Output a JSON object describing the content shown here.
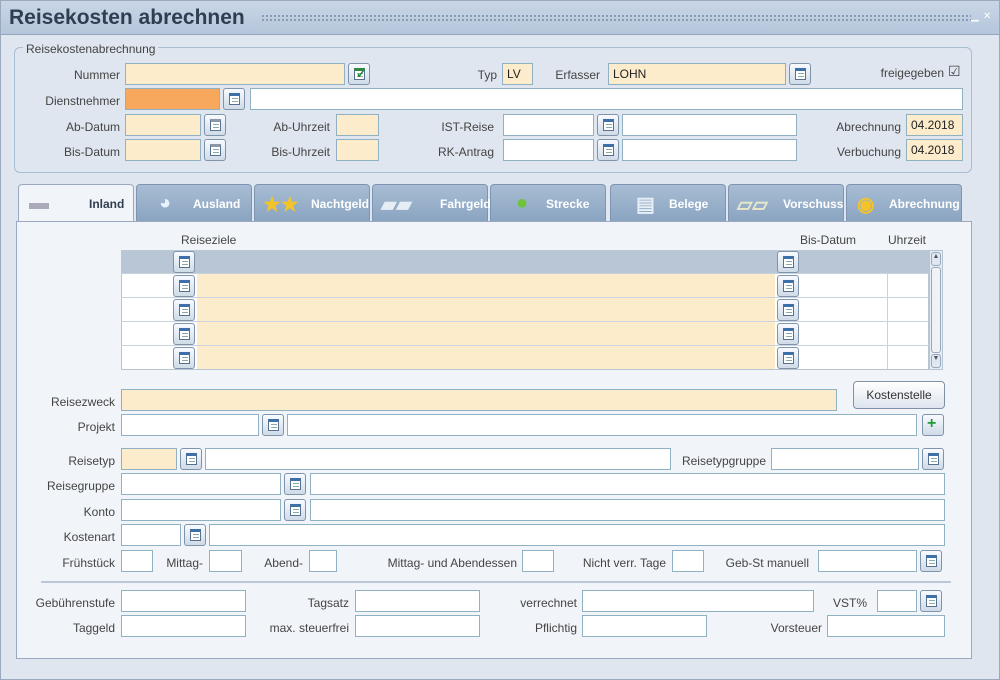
{
  "title": "Reisekosten abrechnen",
  "header": {
    "legend": "Reisekostenabrechnung",
    "nummer_label": "Nummer",
    "typ_label": "Typ",
    "typ_value": "LV",
    "erfasser_label": "Erfasser",
    "erfasser_value": "LOHN",
    "freigegeben_label": "freigegeben",
    "freigegeben_check": "☑",
    "dienstnehmer_label": "Dienstnehmer",
    "ab_datum_label": "Ab-Datum",
    "ab_uhrzeit_label": "Ab-Uhrzeit",
    "ist_reise_label": "IST-Reise",
    "abrechnung_label": "Abrechnung",
    "abrechnung_value": "04.2018",
    "bis_datum_label": "Bis-Datum",
    "bis_uhrzeit_label": "Bis-Uhrzeit",
    "rk_antrag_label": "RK-Antrag",
    "verbuchung_label": "Verbuchung",
    "verbuchung_value": "04.2018"
  },
  "tabs": [
    {
      "label": "Inland",
      "icon": "austria-map-icon"
    },
    {
      "label": "Ausland",
      "icon": "globe-icon"
    },
    {
      "label": "Nachtgeld",
      "icon": "stars-coins-icon"
    },
    {
      "label": "Fahrgeld",
      "icon": "car-coins-icon"
    },
    {
      "label": "Strecke",
      "icon": "map-pin-icon"
    },
    {
      "label": "Belege",
      "icon": "receipt-icon"
    },
    {
      "label": "Vorschuss",
      "icon": "banknotes-icon"
    },
    {
      "label": "Abrechnung",
      "icon": "coin-stack-icon"
    }
  ],
  "grid": {
    "col_reiseziele": "Reiseziele",
    "col_bis_datum": "Bis-Datum",
    "col_uhrzeit": "Uhrzeit"
  },
  "form": {
    "reisezweck": "Reisezweck",
    "kostenstelle_btn": "Kostenstelle",
    "projekt": "Projekt",
    "reisetyp": "Reisetyp",
    "reisetypgruppe": "Reisetypgruppe",
    "reisegruppe": "Reisegruppe",
    "konto": "Konto",
    "kostenart": "Kostenart",
    "fruehstueck": "Frühstück",
    "mittag": "Mittag-",
    "abend": "Abend-",
    "mittag_abendessen": "Mittag- und Abendessen",
    "nicht_verr_tage": "Nicht verr. Tage",
    "geb_st_manuell": "Geb-St manuell",
    "gebuehrenstufe": "Gebührenstufe",
    "tagsatz": "Tagsatz",
    "verrechnet": "verrechnet",
    "vst": "VST%",
    "taggeld": "Taggeld",
    "max_steuerfrei": "max. steuerfrei",
    "pflichtig": "Pflichtig",
    "vorsteuer": "Vorsteuer"
  }
}
